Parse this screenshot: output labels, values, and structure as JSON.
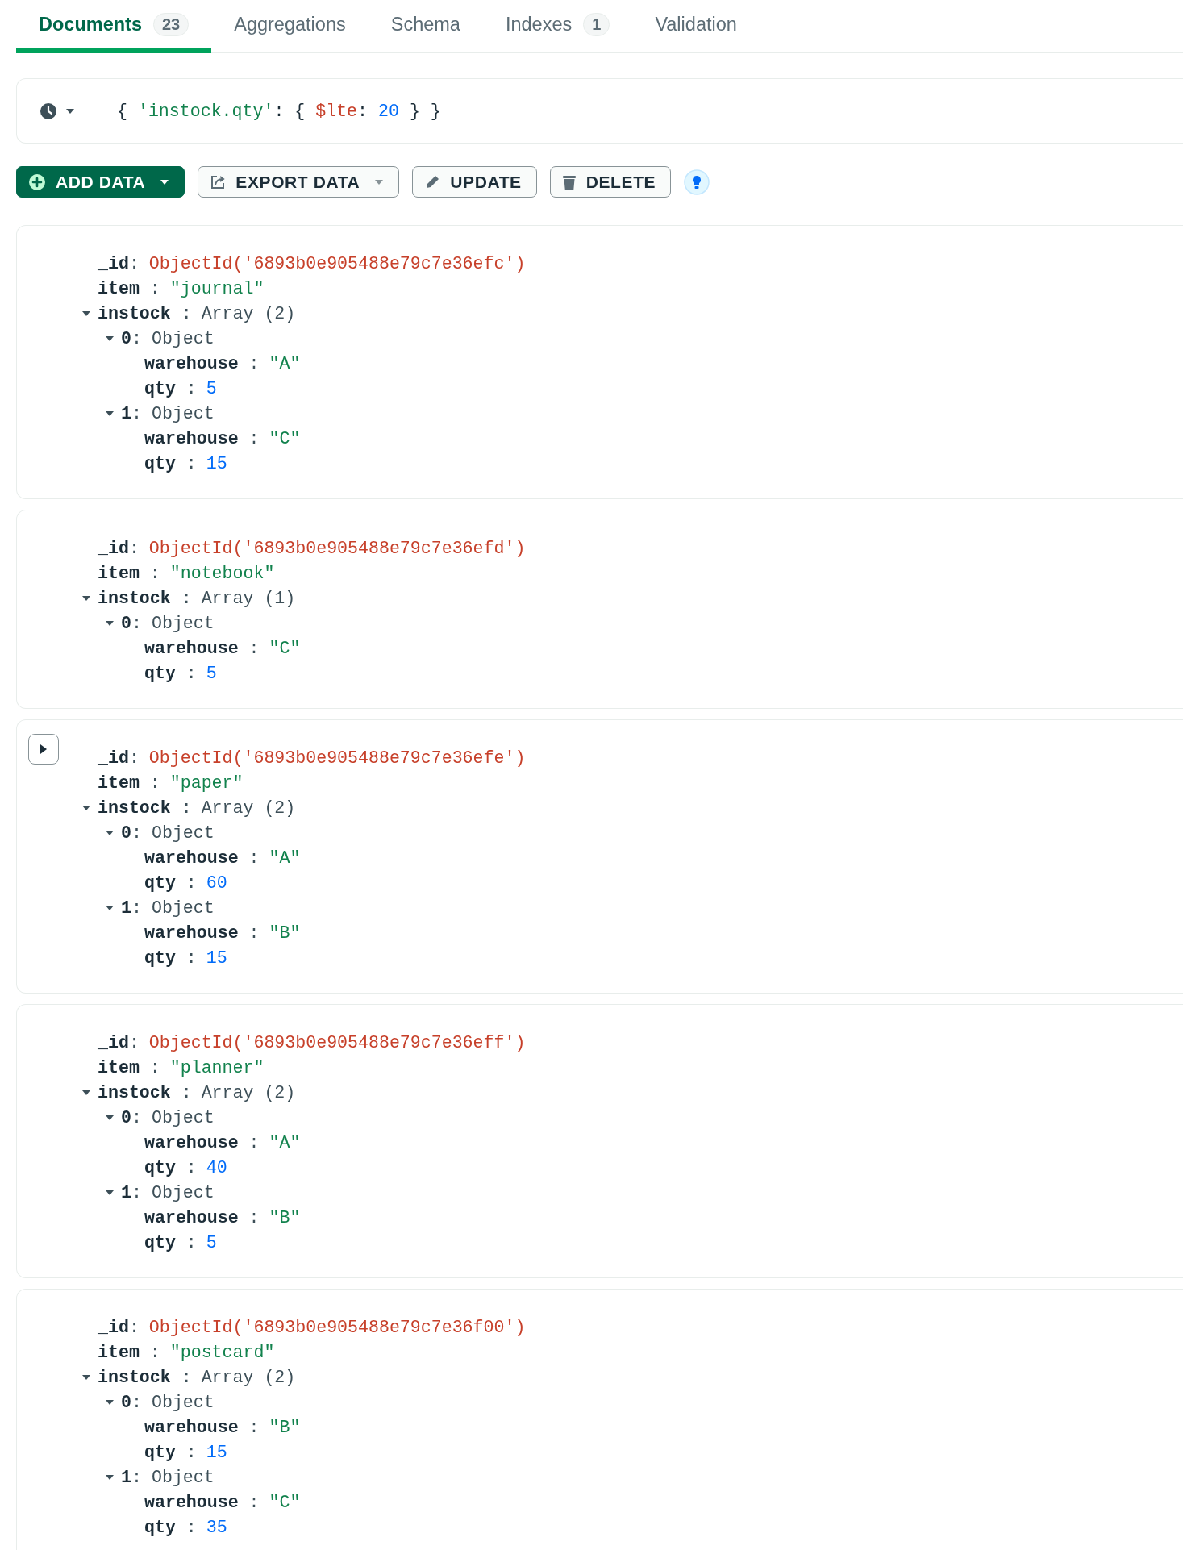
{
  "tabs": [
    {
      "label": "Documents",
      "count": "23",
      "selected": true
    },
    {
      "label": "Aggregations",
      "selected": false
    },
    {
      "label": "Schema",
      "selected": false
    },
    {
      "label": "Indexes",
      "count": "1",
      "selected": false
    },
    {
      "label": "Validation",
      "selected": false
    }
  ],
  "query": {
    "tokens": [
      {
        "text": "{ ",
        "kind": "punct"
      },
      {
        "text": "'instock.qty'",
        "kind": "string"
      },
      {
        "text": ": { ",
        "kind": "punct"
      },
      {
        "text": "$lte",
        "kind": "operator"
      },
      {
        "text": ": ",
        "kind": "punct"
      },
      {
        "text": "20",
        "kind": "number"
      },
      {
        "text": " } }",
        "kind": "punct"
      }
    ]
  },
  "toolbar": [
    {
      "label": "ADD DATA",
      "kind": "add",
      "dropdown": true
    },
    {
      "label": "EXPORT DATA",
      "kind": "export",
      "dropdown": true
    },
    {
      "label": "UPDATE",
      "kind": "update",
      "dropdown": false
    },
    {
      "label": "DELETE",
      "kind": "delete",
      "dropdown": false
    },
    {
      "kind": "hint"
    }
  ],
  "documents": [
    {
      "hovered": false,
      "fields": [
        {
          "key": "**_id**:",
          "value": "ObjectId('6893b0e905488e79c7e36efc')",
          "kind": "objectid"
        },
        {
          "key": "**item** :",
          "value": "\"journal\"",
          "kind": "string"
        },
        {
          "key": "**instock** :",
          "value": "Array (2)",
          "kind": "type",
          "expanded": true,
          "children": [
            {
              "key": "**0**:",
              "value": "Object",
              "kind": "type",
              "expanded": true,
              "children": [
                {
                  "key": "**warehouse** :",
                  "value": "\"A\"",
                  "kind": "string"
                },
                {
                  "key": "**qty** :",
                  "value": "5",
                  "kind": "number"
                }
              ]
            },
            {
              "key": "**1**:",
              "value": "Object",
              "kind": "type",
              "expanded": true,
              "children": [
                {
                  "key": "**warehouse** :",
                  "value": "\"C\"",
                  "kind": "string"
                },
                {
                  "key": "**qty** :",
                  "value": "15",
                  "kind": "number"
                }
              ]
            }
          ]
        }
      ]
    },
    {
      "hovered": false,
      "fields": [
        {
          "key": "**_id**:",
          "value": "ObjectId('6893b0e905488e79c7e36efd')",
          "kind": "objectid"
        },
        {
          "key": "**item** :",
          "value": "\"notebook\"",
          "kind": "string"
        },
        {
          "key": "**instock** :",
          "value": "Array (1)",
          "kind": "type",
          "expanded": true,
          "children": [
            {
              "key": "**0**:",
              "value": "Object",
              "kind": "type",
              "expanded": true,
              "children": [
                {
                  "key": "**warehouse** :",
                  "value": "\"C\"",
                  "kind": "string"
                },
                {
                  "key": "**qty** :",
                  "value": "5",
                  "kind": "number"
                }
              ]
            }
          ]
        }
      ]
    },
    {
      "hovered": true,
      "fields": [
        {
          "key": "**_id**:",
          "value": "ObjectId('6893b0e905488e79c7e36efe')",
          "kind": "objectid"
        },
        {
          "key": "**item** :",
          "value": "\"paper\"",
          "kind": "string"
        },
        {
          "key": "**instock** :",
          "value": "Array (2)",
          "kind": "type",
          "expanded": true,
          "children": [
            {
              "key": "**0**:",
              "value": "Object",
              "kind": "type",
              "expanded": true,
              "children": [
                {
                  "key": "**warehouse** :",
                  "value": "\"A\"",
                  "kind": "string"
                },
                {
                  "key": "**qty** :",
                  "value": "60",
                  "kind": "number"
                }
              ]
            },
            {
              "key": "**1**:",
              "value": "Object",
              "kind": "type",
              "expanded": true,
              "children": [
                {
                  "key": "**warehouse** :",
                  "value": "\"B\"",
                  "kind": "string"
                },
                {
                  "key": "**qty** :",
                  "value": "15",
                  "kind": "number"
                }
              ]
            }
          ]
        }
      ]
    },
    {
      "hovered": false,
      "fields": [
        {
          "key": "**_id**:",
          "value": "ObjectId('6893b0e905488e79c7e36eff')",
          "kind": "objectid"
        },
        {
          "key": "**item** :",
          "value": "\"planner\"",
          "kind": "string"
        },
        {
          "key": "**instock** :",
          "value": "Array (2)",
          "kind": "type",
          "expanded": true,
          "children": [
            {
              "key": "**0**:",
              "value": "Object",
              "kind": "type",
              "expanded": true,
              "children": [
                {
                  "key": "**warehouse** :",
                  "value": "\"A\"",
                  "kind": "string"
                },
                {
                  "key": "**qty** :",
                  "value": "40",
                  "kind": "number"
                }
              ]
            },
            {
              "key": "**1**:",
              "value": "Object",
              "kind": "type",
              "expanded": true,
              "children": [
                {
                  "key": "**warehouse** :",
                  "value": "\"B\"",
                  "kind": "string"
                },
                {
                  "key": "**qty** :",
                  "value": "5",
                  "kind": "number"
                }
              ]
            }
          ]
        }
      ]
    },
    {
      "hovered": false,
      "fields": [
        {
          "key": "**_id**:",
          "value": "ObjectId('6893b0e905488e79c7e36f00')",
          "kind": "objectid"
        },
        {
          "key": "**item** :",
          "value": "\"postcard\"",
          "kind": "string"
        },
        {
          "key": "**instock** :",
          "value": "Array (2)",
          "kind": "type",
          "expanded": true,
          "children": [
            {
              "key": "**0**:",
              "value": "Object",
              "kind": "type",
              "expanded": true,
              "children": [
                {
                  "key": "**warehouse** :",
                  "value": "\"B\"",
                  "kind": "string"
                },
                {
                  "key": "**qty** :",
                  "value": "15",
                  "kind": "number"
                }
              ]
            },
            {
              "key": "**1**:",
              "value": "Object",
              "kind": "type",
              "expanded": true,
              "children": [
                {
                  "key": "**warehouse** :",
                  "value": "\"C\"",
                  "kind": "string"
                },
                {
                  "key": "**qty** :",
                  "value": "35",
                  "kind": "number"
                }
              ]
            }
          ]
        }
      ]
    }
  ]
}
